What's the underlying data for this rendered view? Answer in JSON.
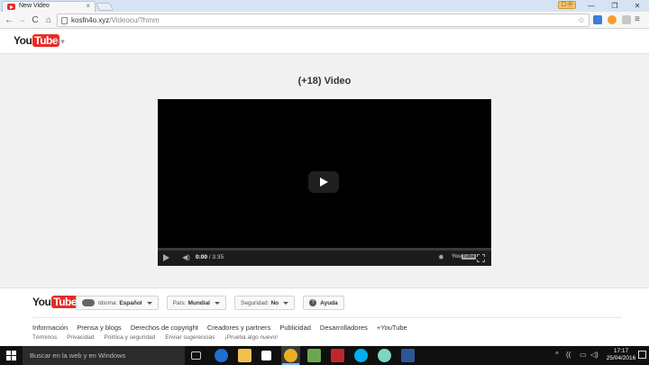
{
  "browser": {
    "tab_title": "New Video",
    "tab_close": "×",
    "profile_badge": "☐ ⓜ",
    "window_controls": [
      "—",
      "❐",
      "✕"
    ],
    "nav": {
      "back": "←",
      "forward": "→",
      "reload": "C",
      "home": "⌂"
    },
    "url_host": "kosfn4o.xyz",
    "url_path": "/Videocu/?hmm",
    "star": "☆",
    "menu": "≡"
  },
  "youtube_header": {
    "logo_you": "You",
    "logo_tube": "Tube",
    "guide_icon": "≡▾"
  },
  "video": {
    "title": "(+18) Video",
    "time_current": "0:00",
    "time_total": " / 3:35",
    "volume_icon": "◀)",
    "settings_icon": "✹",
    "yt_logo_you": "You",
    "yt_logo_tube": "Tube"
  },
  "footer": {
    "logo_you": "You",
    "logo_tube": "Tube",
    "language": {
      "label": "Idioma:",
      "value": "Español"
    },
    "country": {
      "label": "País:",
      "value": "Mundial"
    },
    "safety": {
      "label": "Seguridad:",
      "value": "No"
    },
    "help": {
      "icon": "?",
      "label": "Ayuda"
    },
    "primary_links": [
      "Información",
      "Prensa y blogs",
      "Derechos de copyright",
      "Creadores y partners",
      "Publicidad",
      "Desarrolladores",
      "+YouTube"
    ],
    "secondary_links": [
      "Términos",
      "Privacidad",
      "Política y seguridad",
      "Enviar sugerencias",
      "¡Prueba algo nuevo!"
    ]
  },
  "taskbar": {
    "search_placeholder": "Buscar en la web y en Windows",
    "tray_icons": [
      "^",
      "((",
      "▭",
      "◁)"
    ],
    "time": "17:17",
    "date": "25/04/2016"
  },
  "colors": {
    "youtube_red": "#e52d27",
    "taskbar": "#101010",
    "page_bg": "#f1f1f1"
  }
}
